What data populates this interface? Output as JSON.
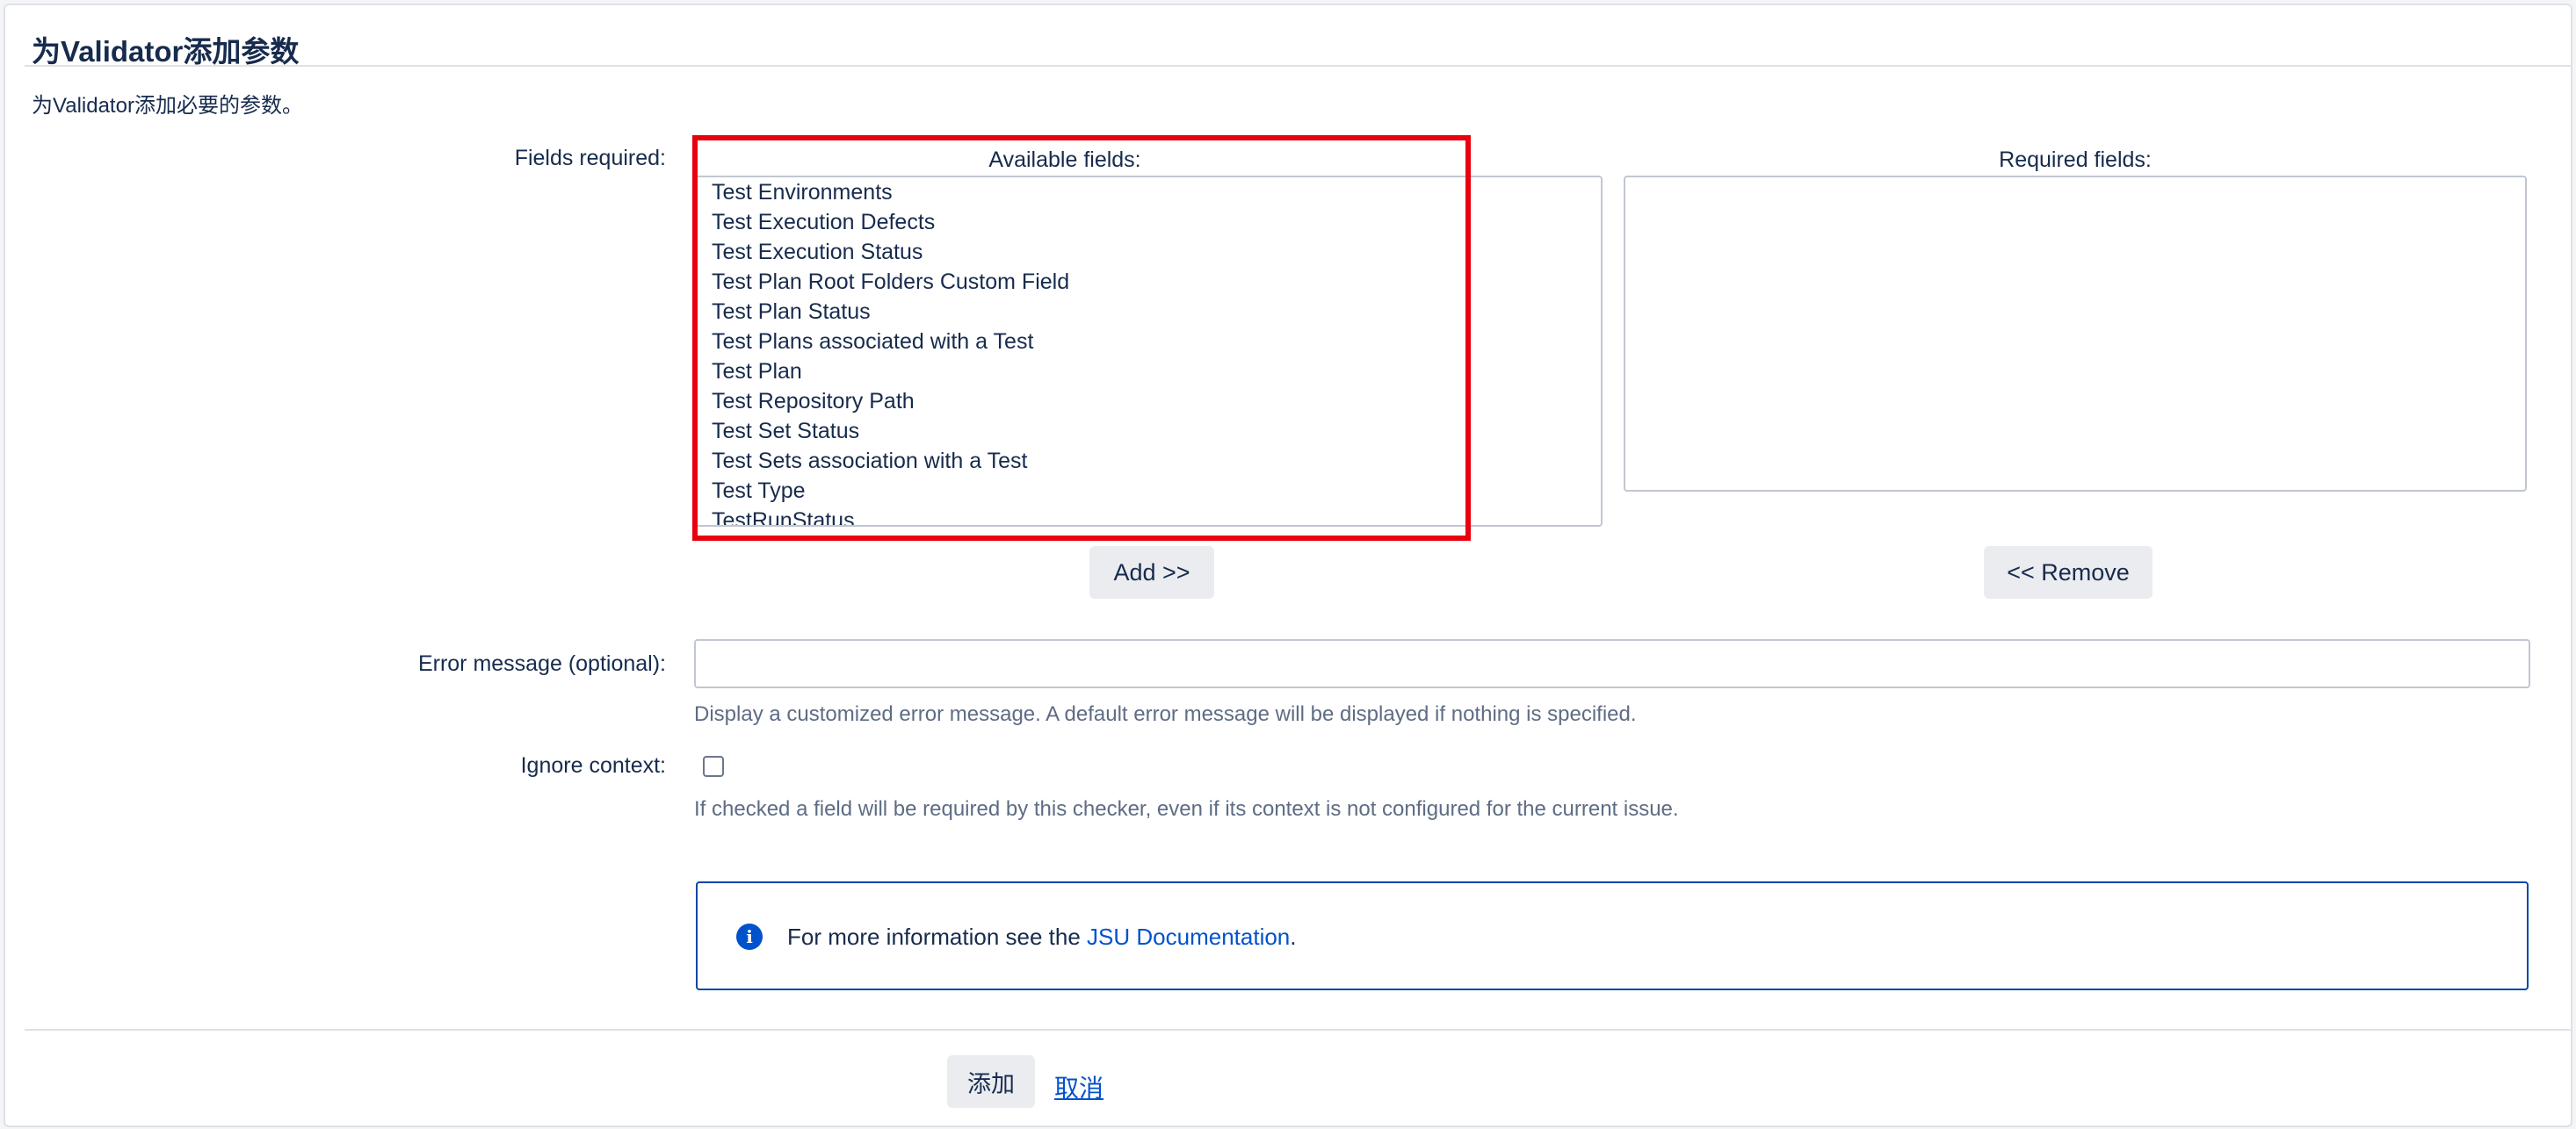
{
  "dialog": {
    "title": "为Validator添加参数",
    "description": "为Validator添加必要的参数。"
  },
  "fields_required": {
    "label": "Fields required:",
    "available": {
      "header": "Available fields:",
      "options": [
        "Test Environments",
        "Test Execution Defects",
        "Test Execution Status",
        "Test Plan Root Folders Custom Field",
        "Test Plan Status",
        "Test Plans associated with a Test",
        "Test Plan",
        "Test Repository Path",
        "Test Set Status",
        "Test Sets association with a Test",
        "Test Type",
        "TestRunStatus"
      ]
    },
    "required": {
      "header": "Required fields:",
      "options": []
    },
    "add_button": "Add >>",
    "remove_button": "<< Remove"
  },
  "error_message": {
    "label": "Error message (optional):",
    "value": "",
    "help": "Display a customized error message. A default error message will be displayed if nothing is specified."
  },
  "ignore_context": {
    "label": "Ignore context:",
    "checked": false,
    "help": "If checked a field will be required by this checker, even if its context is not configured for the current issue."
  },
  "info": {
    "icon": "info-icon",
    "text_before": "For more information see the ",
    "link_text": "JSU Documentation",
    "text_after": "."
  },
  "footer": {
    "submit_label": "添加",
    "cancel_label": "取消"
  },
  "colors": {
    "highlight": "#e8000f",
    "link": "#0052cc",
    "info_border": "#0747a6"
  }
}
